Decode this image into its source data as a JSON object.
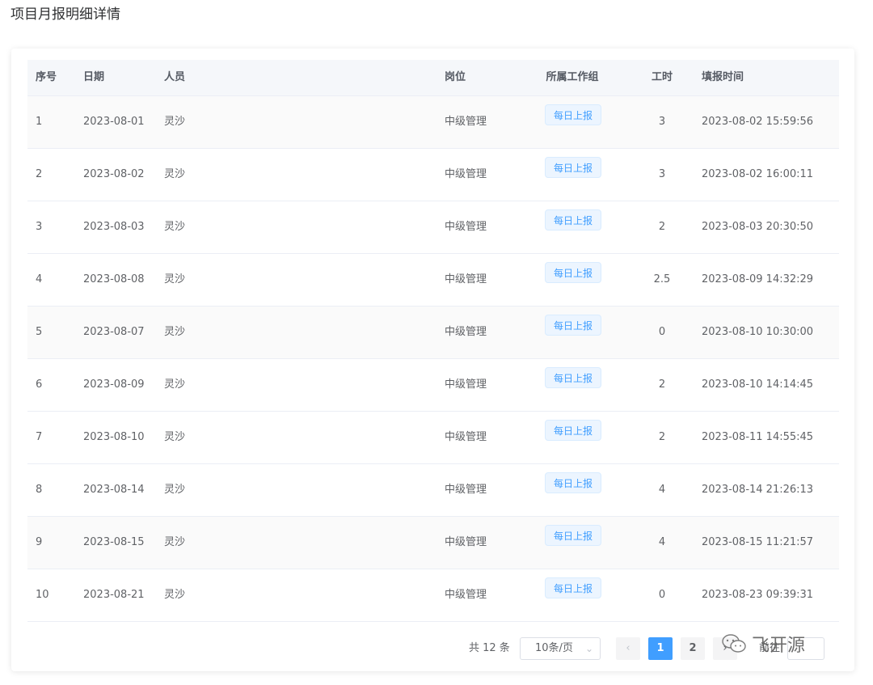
{
  "page": {
    "title": "项目月报明细详情"
  },
  "table": {
    "columns": [
      "序号",
      "日期",
      "人员",
      "岗位",
      "所属工作组",
      "工时",
      "填报时间"
    ],
    "rows": [
      {
        "no": "1",
        "date": "2023-08-01",
        "person": "灵沙",
        "post": "中级管理",
        "group": "每日上报",
        "hours": "3",
        "time": "2023-08-02 15:59:56"
      },
      {
        "no": "2",
        "date": "2023-08-02",
        "person": "灵沙",
        "post": "中级管理",
        "group": "每日上报",
        "hours": "3",
        "time": "2023-08-02 16:00:11"
      },
      {
        "no": "3",
        "date": "2023-08-03",
        "person": "灵沙",
        "post": "中级管理",
        "group": "每日上报",
        "hours": "2",
        "time": "2023-08-03 20:30:50"
      },
      {
        "no": "4",
        "date": "2023-08-08",
        "person": "灵沙",
        "post": "中级管理",
        "group": "每日上报",
        "hours": "2.5",
        "time": "2023-08-09 14:32:29"
      },
      {
        "no": "5",
        "date": "2023-08-07",
        "person": "灵沙",
        "post": "中级管理",
        "group": "每日上报",
        "hours": "0",
        "time": "2023-08-10 10:30:00"
      },
      {
        "no": "6",
        "date": "2023-08-09",
        "person": "灵沙",
        "post": "中级管理",
        "group": "每日上报",
        "hours": "2",
        "time": "2023-08-10 14:14:45"
      },
      {
        "no": "7",
        "date": "2023-08-10",
        "person": "灵沙",
        "post": "中级管理",
        "group": "每日上报",
        "hours": "2",
        "time": "2023-08-11 14:55:45"
      },
      {
        "no": "8",
        "date": "2023-08-14",
        "person": "灵沙",
        "post": "中级管理",
        "group": "每日上报",
        "hours": "4",
        "time": "2023-08-14 21:26:13"
      },
      {
        "no": "9",
        "date": "2023-08-15",
        "person": "灵沙",
        "post": "中级管理",
        "group": "每日上报",
        "hours": "4",
        "time": "2023-08-15 11:21:57"
      },
      {
        "no": "10",
        "date": "2023-08-21",
        "person": "灵沙",
        "post": "中级管理",
        "group": "每日上报",
        "hours": "0",
        "time": "2023-08-23 09:39:31"
      }
    ]
  },
  "pagination": {
    "total_label": "共 12 条",
    "page_size": "10条/页",
    "prev_icon": "‹",
    "pages": [
      "1",
      "2"
    ],
    "current_page": "1",
    "next_icon": "›",
    "goto_label": "前往"
  },
  "watermark": {
    "text": "飞开源",
    "icon": "wechat-icon"
  },
  "colors": {
    "primary": "#409eff",
    "tag_bg": "#ecf5ff",
    "header_bg": "#f5f7fa"
  }
}
